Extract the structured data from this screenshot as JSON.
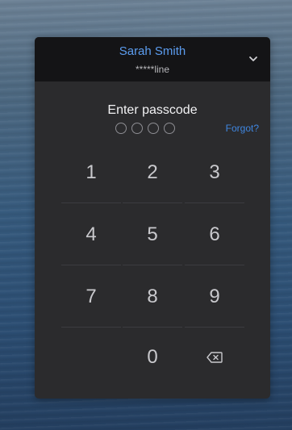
{
  "account": {
    "name": "Sarah Smith",
    "masked_id": "*****line"
  },
  "passcode": {
    "prompt": "Enter passcode",
    "entered_count": 0,
    "length": 4,
    "forgot_label": "Forgot?"
  },
  "keypad": {
    "keys": [
      "1",
      "2",
      "3",
      "4",
      "5",
      "6",
      "7",
      "8",
      "9",
      "0"
    ],
    "delete_icon": "backspace-icon"
  },
  "colors": {
    "accent": "#5c9df0",
    "link": "#3f86e0",
    "panel": "#2b2b2d",
    "header": "#141416"
  }
}
